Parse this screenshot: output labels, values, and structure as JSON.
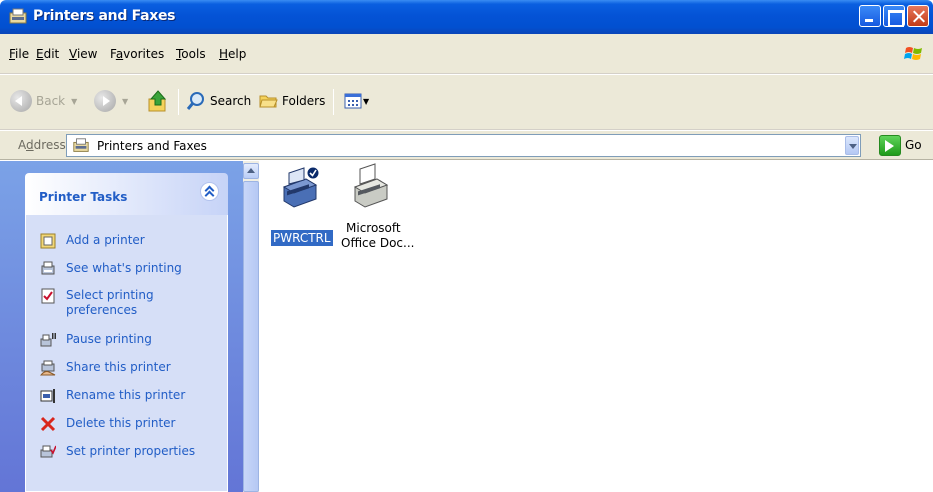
{
  "window": {
    "title": "Printers and Faxes"
  },
  "menu": [
    {
      "accel": "F",
      "rest": "ile"
    },
    {
      "accel": "E",
      "rest": "dit"
    },
    {
      "accel": "V",
      "rest": "iew"
    },
    {
      "pre": "F",
      "accel": "a",
      "rest": "vorites"
    },
    {
      "accel": "T",
      "rest": "ools"
    },
    {
      "accel": "H",
      "rest": "elp"
    }
  ],
  "toolbar": {
    "back_label": "Back",
    "search_label": "Search",
    "folders_label": "Folders"
  },
  "address": {
    "label": "Address",
    "label_accel": "d",
    "value": "Printers and Faxes",
    "go_label": "Go"
  },
  "tasks": {
    "title": "Printer Tasks",
    "items": [
      {
        "label": "Add a printer",
        "icon": "add-printer-icon"
      },
      {
        "label": "See what's printing",
        "icon": "print-queue-icon"
      },
      {
        "label": "Select printing preferences",
        "icon": "preferences-icon"
      },
      {
        "label": "Pause printing",
        "icon": "pause-printer-icon"
      },
      {
        "label": "Share this printer",
        "icon": "share-printer-icon"
      },
      {
        "label": "Rename this printer",
        "icon": "rename-icon"
      },
      {
        "label": "Delete this printer",
        "icon": "delete-icon"
      },
      {
        "label": "Set printer properties",
        "icon": "printer-properties-icon"
      }
    ]
  },
  "printers": [
    {
      "name": "PWRCTRL",
      "selected": true,
      "default": true,
      "icon": "default-printer-icon"
    },
    {
      "name_line1": "Microsoft",
      "name_line2": "Office Doc...",
      "selected": false,
      "icon": "printer-icon"
    }
  ],
  "colors": {
    "titlebar": "#0453d6",
    "taskpane": "#6375d6",
    "task_link": "#215dc6",
    "selection": "#316ac5"
  }
}
